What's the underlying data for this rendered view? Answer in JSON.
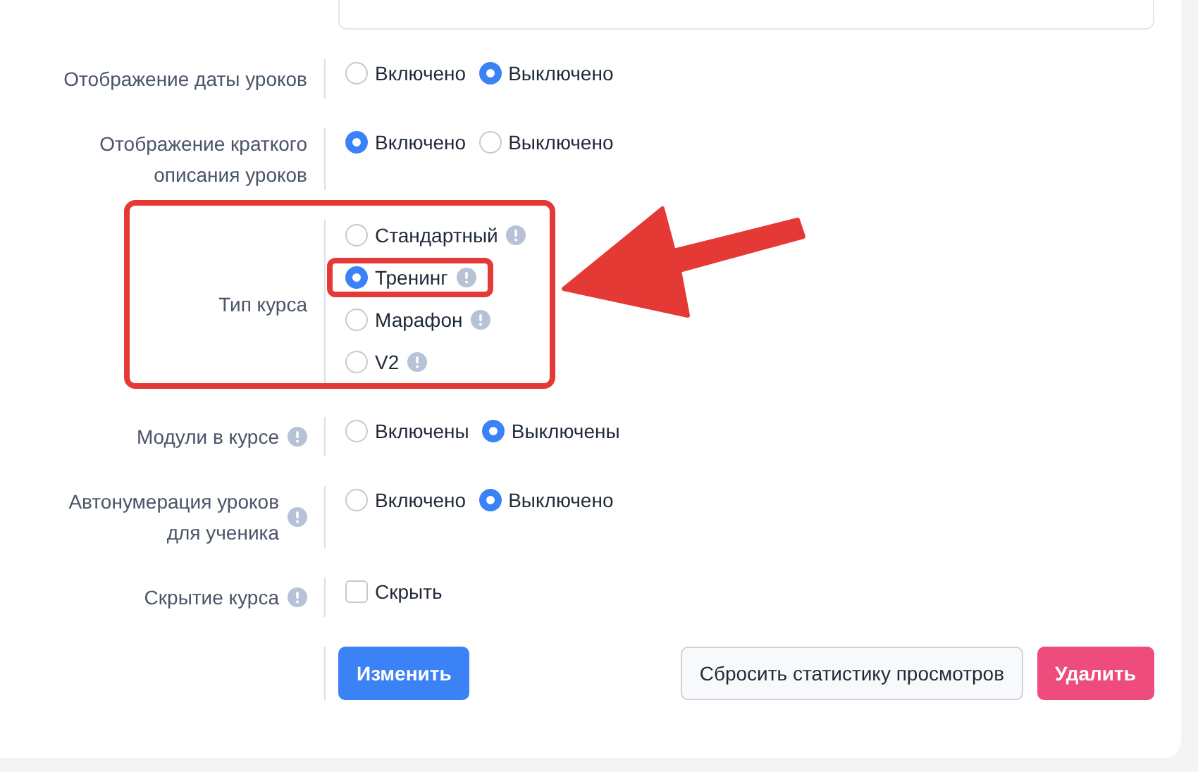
{
  "rows": [
    {
      "kind": "radio",
      "label": "Отображение даты уроков",
      "info": false,
      "highlighted": false,
      "options": [
        {
          "label": "Включено",
          "selected": false,
          "info": false,
          "highlighted": false
        },
        {
          "label": "Выключено",
          "selected": true,
          "info": false,
          "highlighted": false
        }
      ]
    },
    {
      "kind": "radio",
      "label": "Отображение краткого описания уроков",
      "info": false,
      "highlighted": false,
      "options": [
        {
          "label": "Включено",
          "selected": true,
          "info": false,
          "highlighted": false
        },
        {
          "label": "Выключено",
          "selected": false,
          "info": false,
          "highlighted": false
        }
      ]
    },
    {
      "kind": "radio-stack",
      "label": "Тип курса",
      "info": false,
      "highlighted": true,
      "options": [
        {
          "label": "Стандартный",
          "selected": false,
          "info": true,
          "highlighted": false
        },
        {
          "label": "Тренинг",
          "selected": true,
          "info": true,
          "highlighted": true
        },
        {
          "label": "Марафон",
          "selected": false,
          "info": true,
          "highlighted": false
        },
        {
          "label": "V2",
          "selected": false,
          "info": true,
          "highlighted": false
        }
      ]
    },
    {
      "kind": "radio",
      "label": "Модули в курсе",
      "info": true,
      "highlighted": false,
      "options": [
        {
          "label": "Включены",
          "selected": false,
          "info": false,
          "highlighted": false
        },
        {
          "label": "Выключены",
          "selected": true,
          "info": false,
          "highlighted": false
        }
      ]
    },
    {
      "kind": "radio",
      "label": "Автонумерация уроков для ученика",
      "info": true,
      "highlighted": false,
      "options": [
        {
          "label": "Включено",
          "selected": false,
          "info": false,
          "highlighted": false
        },
        {
          "label": "Выключено",
          "selected": true,
          "info": false,
          "highlighted": false
        }
      ]
    },
    {
      "kind": "checkbox",
      "label": "Скрытие курса",
      "info": true,
      "highlighted": false,
      "checkbox": {
        "label": "Скрыть",
        "checked": false
      }
    }
  ],
  "buttons": [
    {
      "label": "Изменить",
      "kind": "primary"
    },
    {
      "label": "Сбросить статистику просмотров",
      "kind": "secondary"
    },
    {
      "label": "Удалить",
      "kind": "danger"
    }
  ],
  "arrow": true
}
